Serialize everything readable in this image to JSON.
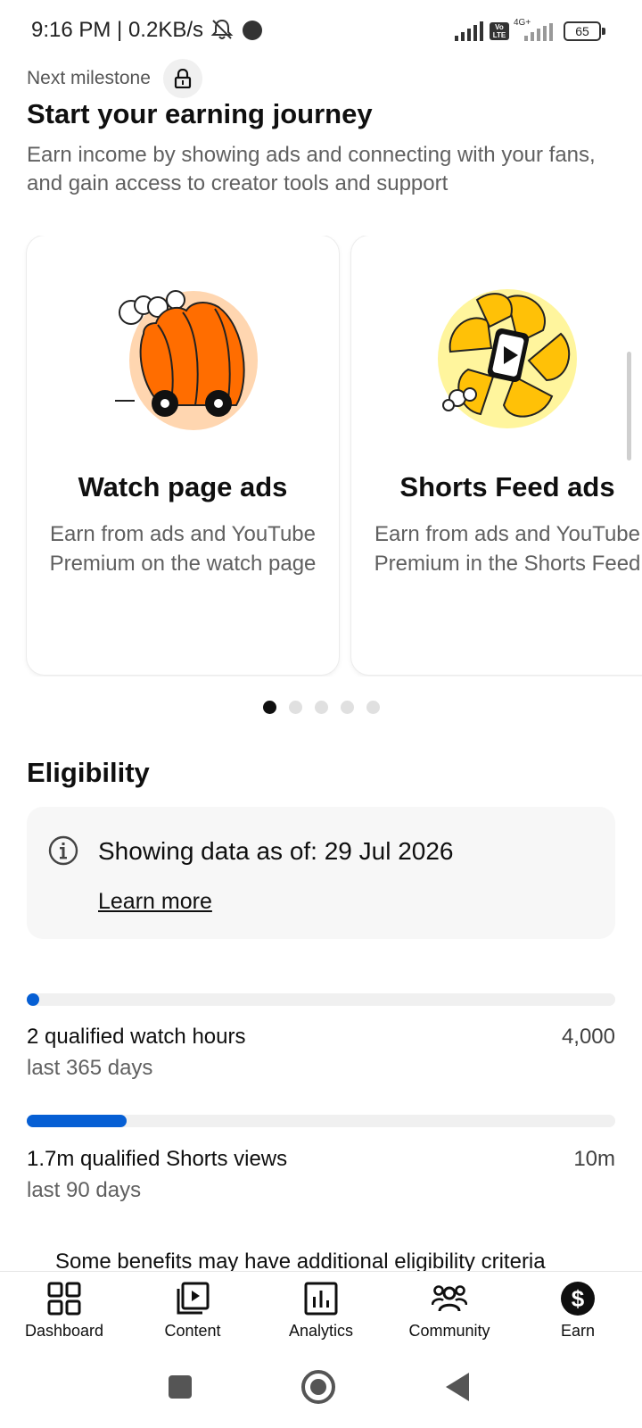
{
  "status_bar": {
    "time": "9:16 PM | 0.2KB/s",
    "network_label": "4G+",
    "volte_label": "Vo LTE",
    "battery": "65"
  },
  "header": {
    "milestone_label": "Next milestone",
    "title": "Start your earning journey",
    "description": "Earn income by showing ads and connecting with your fans, and gain access to creator tools and support"
  },
  "carousel": {
    "cards": [
      {
        "title": "Watch page ads",
        "description": "Earn from ads and YouTube Premium on the watch page",
        "illustration": "orange-cart-illustration"
      },
      {
        "title": "Shorts Feed ads",
        "description": "Earn from ads and YouTube Premium in the Shorts Feed",
        "illustration": "yellow-shorts-illustration"
      }
    ],
    "page_count": 5,
    "active_page": 1
  },
  "eligibility": {
    "title": "Eligibility",
    "info_text": "Showing data as of: 29 Jul 2026",
    "learn_more": "Learn more",
    "metrics": [
      {
        "label": "2 qualified watch hours",
        "period": "last 365 days",
        "goal": "4,000",
        "progress_percent": 0.05
      },
      {
        "label": "1.7m qualified Shorts views",
        "period": "last 90 days",
        "goal": "10m",
        "progress_percent": 17
      }
    ],
    "benefits_note": "Some benefits may have additional eligibility criteria"
  },
  "bottom_nav": {
    "items": [
      {
        "label": "Dashboard",
        "icon": "dashboard-icon"
      },
      {
        "label": "Content",
        "icon": "content-icon"
      },
      {
        "label": "Analytics",
        "icon": "analytics-icon"
      },
      {
        "label": "Community",
        "icon": "community-icon"
      },
      {
        "label": "Earn",
        "icon": "earn-icon",
        "active": true
      }
    ]
  },
  "colors": {
    "accent_blue": "#065fd4",
    "orange": "#ff6d00",
    "yellow": "#ffc107"
  }
}
